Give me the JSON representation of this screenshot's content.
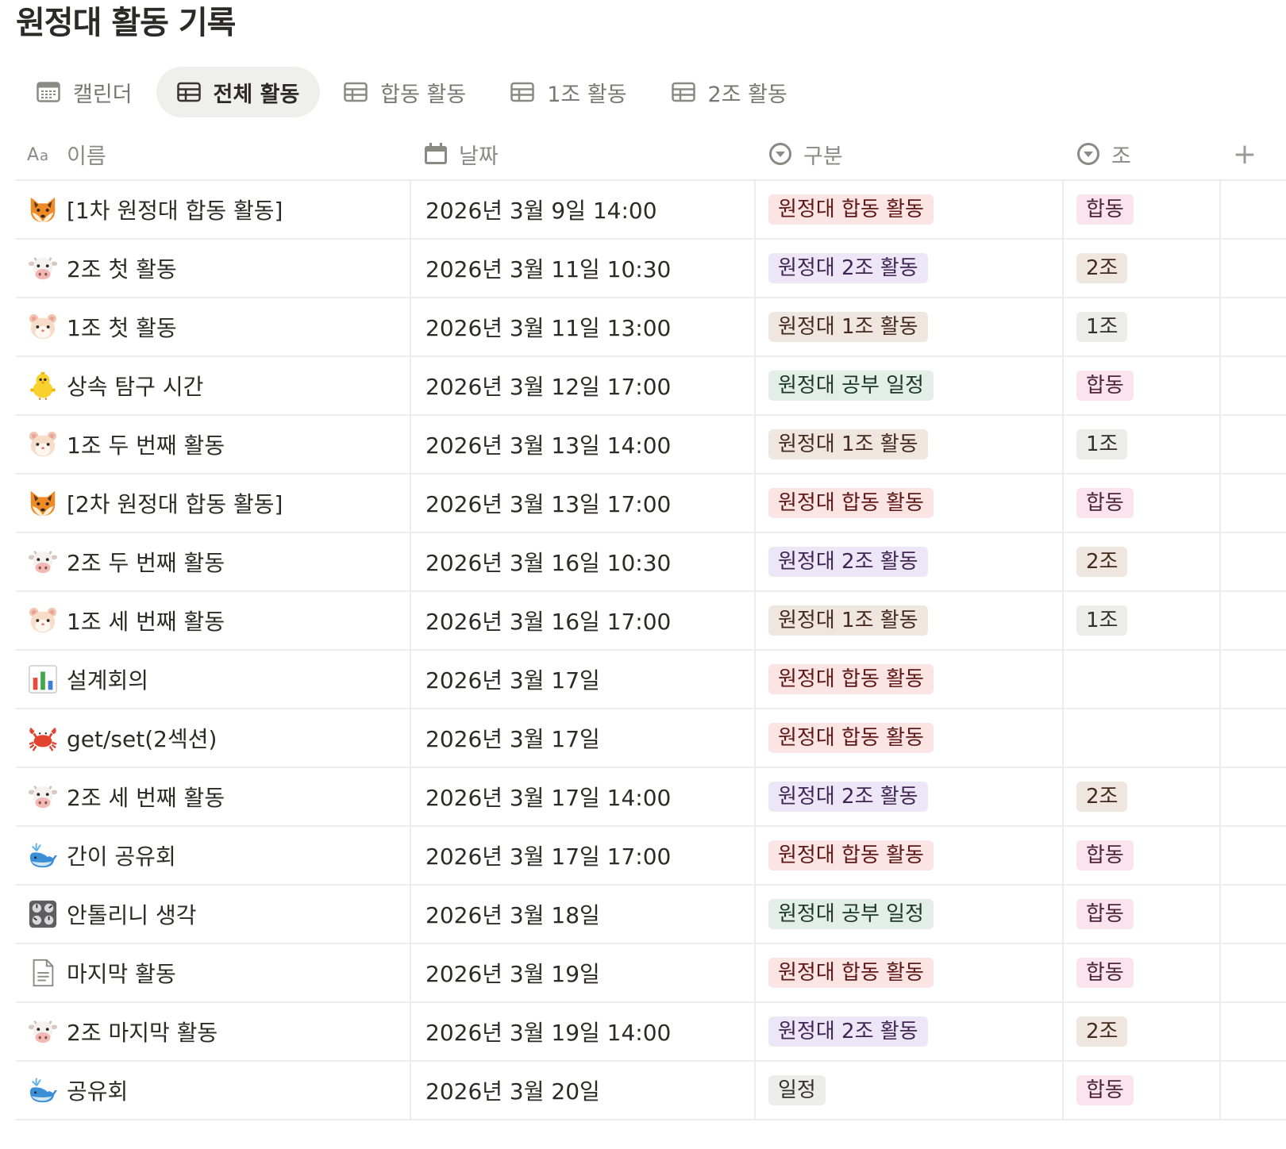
{
  "page": {
    "title": "원정대 활동 기록"
  },
  "views": [
    {
      "label": "캘린더",
      "icon": "calendar-icon",
      "active": false
    },
    {
      "label": "전체 활동",
      "icon": "table-icon",
      "active": true
    },
    {
      "label": "합동 활동",
      "icon": "table-icon",
      "active": false
    },
    {
      "label": "1조 활동",
      "icon": "table-icon",
      "active": false
    },
    {
      "label": "2조 활동",
      "icon": "table-icon",
      "active": false
    }
  ],
  "columns": {
    "name": {
      "label": "이름",
      "icon": "text-property-icon"
    },
    "date": {
      "label": "날짜",
      "icon": "calendar-property-icon"
    },
    "category": {
      "label": "구분",
      "icon": "select-property-icon"
    },
    "group": {
      "label": "조",
      "icon": "select-property-icon"
    },
    "add": "+"
  },
  "tag_colors": {
    "red": {
      "bg": "#fbe4e4",
      "fg": "#5d1715"
    },
    "purple": {
      "bg": "#ece6f7",
      "fg": "#412454"
    },
    "brown": {
      "bg": "#efe6df",
      "fg": "#442a1e"
    },
    "green": {
      "bg": "#e3eee6",
      "fg": "#1c3829"
    },
    "gray": {
      "bg": "#ececeb",
      "fg": "#32302c"
    },
    "pink": {
      "bg": "#fbe4ee",
      "fg": "#4c2337"
    }
  },
  "rows": [
    {
      "icon": "fox-icon",
      "name": "[1차 원정대 합동 활동]",
      "date": "2026년 3월 9일 14:00",
      "category": {
        "label": "원정대 합동 활동",
        "color": "red"
      },
      "group": {
        "label": "합동",
        "color": "pink"
      }
    },
    {
      "icon": "cow-icon",
      "name": "2조 첫 활동",
      "date": "2026년 3월 11일 10:30",
      "category": {
        "label": "원정대 2조 활동",
        "color": "purple"
      },
      "group": {
        "label": "2조",
        "color": "brown"
      }
    },
    {
      "icon": "hamster-icon",
      "name": "1조 첫 활동",
      "date": "2026년 3월 11일 13:00",
      "category": {
        "label": "원정대 1조 활동",
        "color": "brown"
      },
      "group": {
        "label": "1조",
        "color": "gray"
      }
    },
    {
      "icon": "chick-icon",
      "name": "상속 탐구 시간",
      "date": "2026년 3월 12일 17:00",
      "category": {
        "label": "원정대 공부 일정",
        "color": "green"
      },
      "group": {
        "label": "합동",
        "color": "pink"
      }
    },
    {
      "icon": "hamster-icon",
      "name": "1조 두 번째 활동",
      "date": "2026년 3월 13일 14:00",
      "category": {
        "label": "원정대 1조 활동",
        "color": "brown"
      },
      "group": {
        "label": "1조",
        "color": "gray"
      }
    },
    {
      "icon": "fox-icon",
      "name": "[2차 원정대 합동 활동]",
      "date": "2026년 3월 13일 17:00",
      "category": {
        "label": "원정대 합동 활동",
        "color": "red"
      },
      "group": {
        "label": "합동",
        "color": "pink"
      }
    },
    {
      "icon": "cow-icon",
      "name": "2조 두 번째 활동",
      "date": "2026년 3월 16일 10:30",
      "category": {
        "label": "원정대 2조 활동",
        "color": "purple"
      },
      "group": {
        "label": "2조",
        "color": "brown"
      }
    },
    {
      "icon": "hamster-icon",
      "name": "1조 세 번째 활동",
      "date": "2026년 3월 16일 17:00",
      "category": {
        "label": "원정대 1조 활동",
        "color": "brown"
      },
      "group": {
        "label": "1조",
        "color": "gray"
      }
    },
    {
      "icon": "bar-chart-icon",
      "name": "설계회의",
      "date": "2026년 3월 17일",
      "category": {
        "label": "원정대 합동 활동",
        "color": "red"
      },
      "group": null
    },
    {
      "icon": "crab-icon",
      "name": "get/set(2섹션)",
      "date": "2026년 3월 17일",
      "category": {
        "label": "원정대 합동 활동",
        "color": "red"
      },
      "group": null
    },
    {
      "icon": "cow-icon",
      "name": "2조 세 번째 활동",
      "date": "2026년 3월 17일 14:00",
      "category": {
        "label": "원정대 2조 활동",
        "color": "purple"
      },
      "group": {
        "label": "2조",
        "color": "brown"
      }
    },
    {
      "icon": "whale-icon",
      "name": "간이 공유회",
      "date": "2026년 3월 17일 17:00",
      "category": {
        "label": "원정대 합동 활동",
        "color": "red"
      },
      "group": {
        "label": "합동",
        "color": "pink"
      }
    },
    {
      "icon": "control-knobs-icon",
      "name": "안톨리니 생각",
      "date": "2026년 3월 18일",
      "category": {
        "label": "원정대 공부 일정",
        "color": "green"
      },
      "group": {
        "label": "합동",
        "color": "pink"
      }
    },
    {
      "icon": "document-icon",
      "name": "마지막 활동",
      "date": "2026년 3월 19일",
      "category": {
        "label": "원정대 합동 활동",
        "color": "red"
      },
      "group": {
        "label": "합동",
        "color": "pink"
      }
    },
    {
      "icon": "cow-icon",
      "name": "2조 마지막 활동",
      "date": "2026년 3월 19일 14:00",
      "category": {
        "label": "원정대 2조 활동",
        "color": "purple"
      },
      "group": {
        "label": "2조",
        "color": "brown"
      }
    },
    {
      "icon": "whale-icon",
      "name": "공유회",
      "date": "2026년 3월 20일",
      "category": {
        "label": "일정",
        "color": "gray"
      },
      "group": {
        "label": "합동",
        "color": "pink"
      }
    }
  ]
}
